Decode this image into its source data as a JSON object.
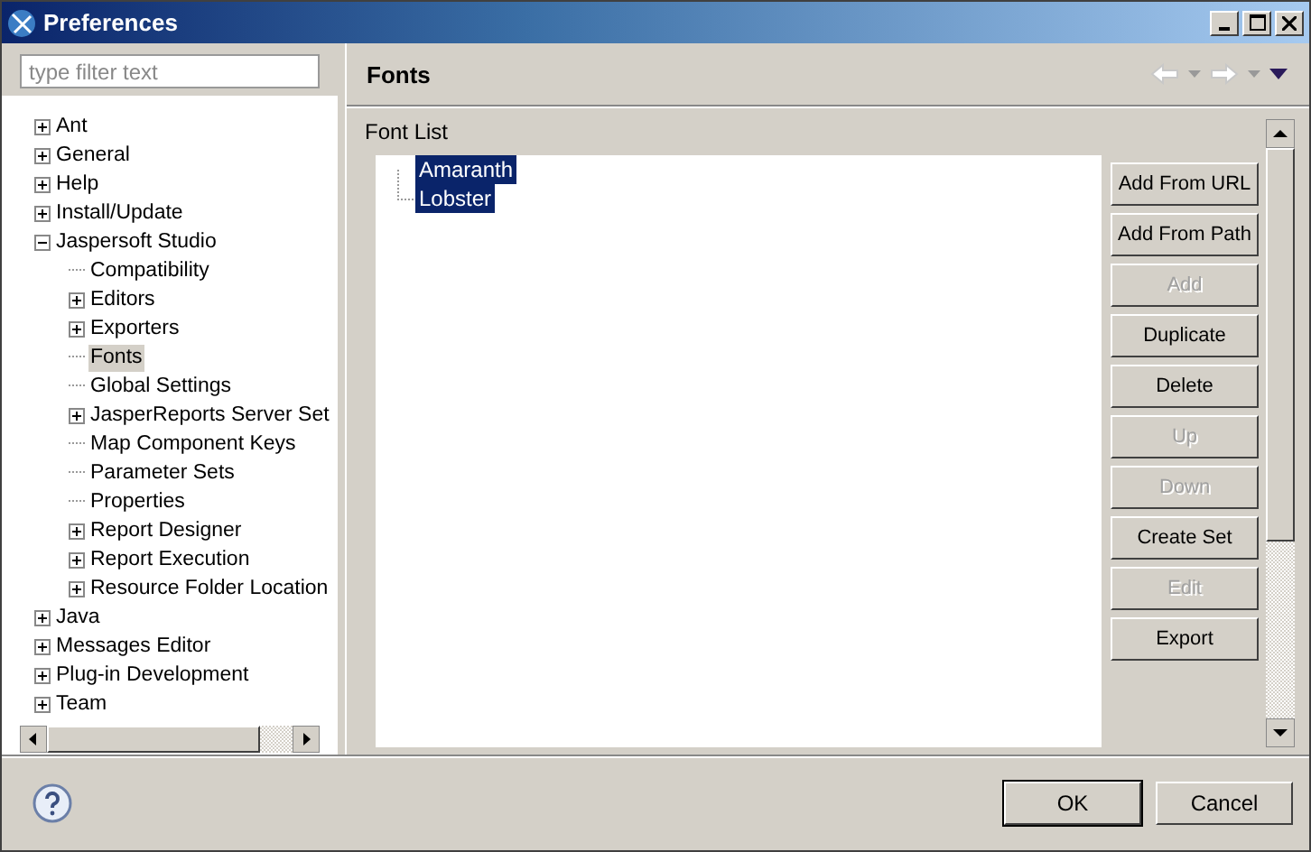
{
  "window": {
    "title": "Preferences"
  },
  "filter": {
    "placeholder": "type filter text"
  },
  "tree": [
    {
      "label": "Ant",
      "expanded": false,
      "selected": false
    },
    {
      "label": "General",
      "expanded": false,
      "selected": false
    },
    {
      "label": "Help",
      "expanded": false,
      "selected": false
    },
    {
      "label": "Install/Update",
      "expanded": false,
      "selected": false
    },
    {
      "label": "Jaspersoft Studio",
      "expanded": true,
      "selected": false,
      "children": [
        {
          "label": "Compatibility",
          "selected": false
        },
        {
          "label": "Editors",
          "expanded": false,
          "selected": false
        },
        {
          "label": "Exporters",
          "expanded": false,
          "selected": false
        },
        {
          "label": "Fonts",
          "selected": true
        },
        {
          "label": "Global Settings",
          "selected": false
        },
        {
          "label": "JasperReports Server Set",
          "expanded": false,
          "selected": false
        },
        {
          "label": "Map Component Keys",
          "selected": false
        },
        {
          "label": "Parameter Sets",
          "selected": false
        },
        {
          "label": "Properties",
          "selected": false
        },
        {
          "label": "Report Designer",
          "expanded": false,
          "selected": false
        },
        {
          "label": "Report Execution",
          "expanded": false,
          "selected": false
        },
        {
          "label": "Resource Folder Location",
          "expanded": false,
          "selected": false
        }
      ]
    },
    {
      "label": "Java",
      "expanded": false,
      "selected": false
    },
    {
      "label": "Messages Editor",
      "expanded": false,
      "selected": false
    },
    {
      "label": "Plug-in Development",
      "expanded": false,
      "selected": false
    },
    {
      "label": "Team",
      "expanded": false,
      "selected": false
    }
  ],
  "page": {
    "title": "Fonts",
    "section": "Font List",
    "fonts": [
      {
        "label": "Amaranth",
        "selected": true
      },
      {
        "label": "Lobster",
        "selected": true
      }
    ],
    "buttons": [
      {
        "label": "Add From URL",
        "disabled": false
      },
      {
        "label": "Add From Path",
        "disabled": false
      },
      {
        "label": "Add",
        "disabled": true
      },
      {
        "label": "Duplicate",
        "disabled": false
      },
      {
        "label": "Delete",
        "disabled": false
      },
      {
        "label": "Up",
        "disabled": true
      },
      {
        "label": "Down",
        "disabled": true
      },
      {
        "label": "Create Set",
        "disabled": false
      },
      {
        "label": "Edit",
        "disabled": true
      },
      {
        "label": "Export",
        "disabled": false
      }
    ]
  },
  "footer": {
    "buttons": [
      {
        "label": "OK",
        "default": true
      },
      {
        "label": "Cancel",
        "default": false
      }
    ]
  }
}
